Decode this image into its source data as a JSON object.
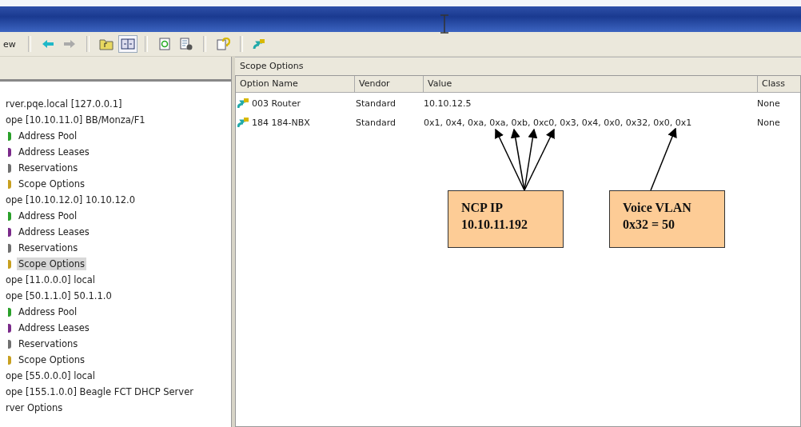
{
  "toolbar": {
    "menu_label": "ew",
    "buttons": [
      {
        "disabled": false,
        "pressed": false
      },
      {
        "disabled": true,
        "pressed": false
      },
      {
        "pressed": false
      },
      {
        "pressed": true
      },
      {
        "pressed": false
      },
      {
        "pressed": false
      },
      {
        "pressed": false
      },
      {
        "pressed": false
      }
    ]
  },
  "tree": [
    {
      "label": "rver.pqe.local [127.0.0.1]",
      "selected": false,
      "children": [
        {
          "label": "ope [10.10.11.0] BB/Monza/F1",
          "selected": false,
          "children": [
            {
              "label": "Address Pool",
              "selected": false,
              "color": "#2aa02a"
            },
            {
              "label": "Address Leases",
              "selected": false,
              "color": "#7a2a8a"
            },
            {
              "label": "Reservations",
              "selected": false,
              "color": "#707070"
            },
            {
              "label": "Scope Options",
              "selected": false,
              "color": "#c8a020"
            }
          ]
        },
        {
          "label": "ope [10.10.12.0] 10.10.12.0",
          "selected": false,
          "children": [
            {
              "label": "Address Pool",
              "selected": false,
              "color": "#2aa02a"
            },
            {
              "label": "Address Leases",
              "selected": false,
              "color": "#7a2a8a"
            },
            {
              "label": "Reservations",
              "selected": false,
              "color": "#707070"
            },
            {
              "label": "Scope Options",
              "selected": true,
              "color": "#c8a020"
            }
          ]
        },
        {
          "label": "ope [11.0.0.0] local",
          "selected": false
        },
        {
          "label": "ope [50.1.1.0] 50.1.1.0",
          "selected": false,
          "children": [
            {
              "label": "Address Pool",
              "selected": false,
              "color": "#2aa02a"
            },
            {
              "label": "Address Leases",
              "selected": false,
              "color": "#7a2a8a"
            },
            {
              "label": "Reservations",
              "selected": false,
              "color": "#707070"
            },
            {
              "label": "Scope Options",
              "selected": false,
              "color": "#c8a020"
            }
          ]
        },
        {
          "label": "ope [55.0.0.0] local",
          "selected": false
        },
        {
          "label": "ope [155.1.0.0] Beagle FCT DHCP Server",
          "selected": false
        },
        {
          "label": "rver Options",
          "selected": false
        }
      ]
    }
  ],
  "panel": {
    "title": "Scope Options",
    "columns": [
      "Option Name",
      "Vendor",
      "Value",
      "Class"
    ],
    "rows": [
      {
        "cells": [
          "003 Router",
          "Standard",
          "10.10.12.5",
          "None"
        ]
      },
      {
        "cells": [
          "184 184-NBX",
          "Standard",
          "0x1, 0x4, 0xa, 0xa, 0xb, 0xc0, 0x3, 0x4, 0x0, 0x32, 0x0, 0x1",
          "None"
        ]
      }
    ]
  },
  "callouts": [
    {
      "lines": [
        "NCP IP",
        "10.10.11.192"
      ]
    },
    {
      "lines": [
        "Voice VLAN",
        "0x32 = 50"
      ]
    }
  ]
}
